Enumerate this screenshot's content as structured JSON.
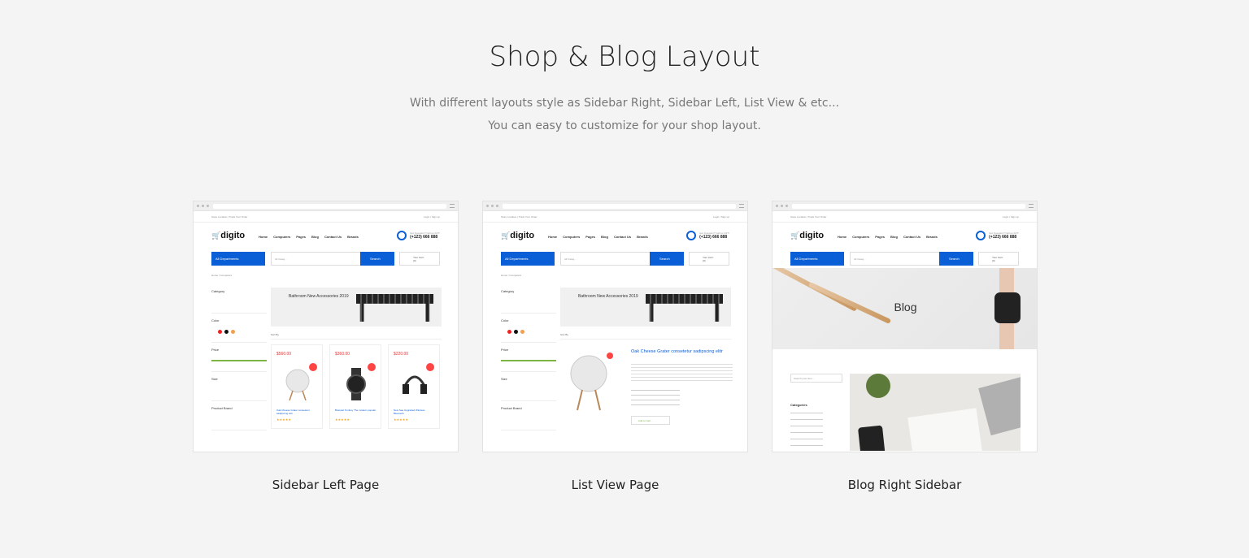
{
  "heading": "Shop & Blog Layout",
  "subtitle_line1": "With different layouts style as Sidebar Right, Sidebar Left, List View & etc...",
  "subtitle_line2": "You can easy to customize for your shop layout.",
  "accent_color": "#0a5fd6",
  "cards": [
    {
      "caption": "Sidebar Left Page"
    },
    {
      "caption": "List View Page"
    },
    {
      "caption": "Blog Right Sidebar"
    }
  ],
  "mockup": {
    "topbar_left": "Store Location  |  Track Your Order",
    "topbar_right": "Login / Sign up",
    "logo": "digito",
    "nav": [
      "Home",
      "Computers",
      "Pages",
      "Blog",
      "Contact Us",
      "Brands"
    ],
    "support_label": "Got Question? Call us 24/7!",
    "support_phone": "(+123) 666 888",
    "departments": "All Departments",
    "category_select": "All Categ...",
    "search_placeholder": "Search here...",
    "search_button": "Search",
    "cart_label": "Your Cart : (0)",
    "cart_total": "$0.00",
    "breadcrumb": "Home / Computers",
    "sidebar": [
      "Category",
      "Color",
      "Price",
      "Size",
      "Product Brand"
    ],
    "price_range": "$200.00 - $770.00",
    "banner_title": "Bathroom New Accessories 2019",
    "sort_by": "Sort By",
    "products": [
      {
        "price": "$560.00",
        "name": "Oak Cheese Grater consetetur sadipscing elitr",
        "stars": "★★★★★"
      },
      {
        "price": "$360.00",
        "name": "Bracelet Tomboy The modern popular",
        "stars": "★★★★★"
      },
      {
        "price": "$220.00",
        "name": "New Sea Upgraded Wireless Bluetooth",
        "stars": "★★★★★"
      }
    ],
    "list_title": "Oak Cheese Grater consetetur sadipscing elitr",
    "add_to_cart": "Add to Cart",
    "blog_title": "Blog",
    "blog_search": "Search post here...",
    "categories": "Categories"
  }
}
